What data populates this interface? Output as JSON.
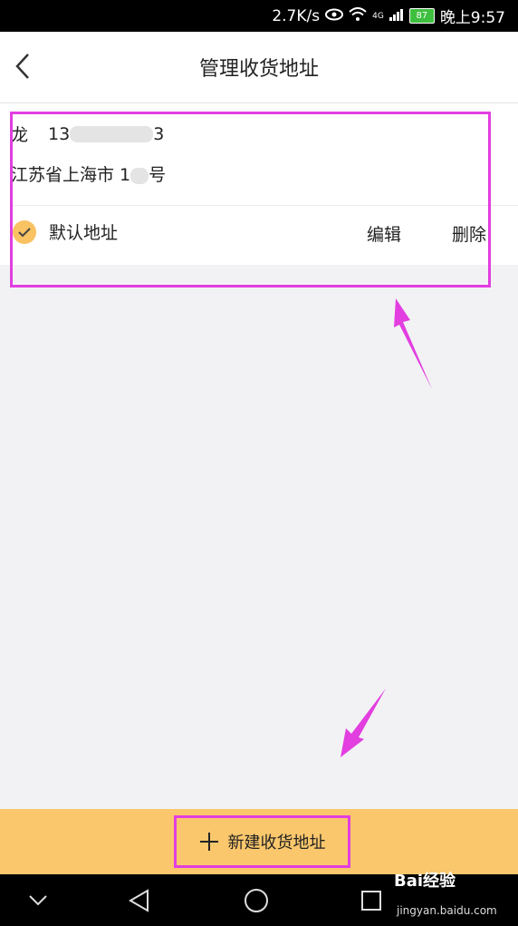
{
  "status_bar": {
    "speed": "2.7K/s",
    "network": "4G",
    "battery": "87",
    "time": "晚上9:57"
  },
  "header": {
    "title": "管理收货地址"
  },
  "address": {
    "name": "龙",
    "phone_start": "13",
    "phone_end": "3",
    "region": "江苏省上海市 1",
    "house_suffix": "号",
    "default_label": "默认地址",
    "edit_label": "编辑",
    "delete_label": "删除"
  },
  "footer": {
    "new_address_label": "新建收货地址"
  },
  "watermark": {
    "brand": "Bai经验",
    "url": "jingyan.baidu.com"
  },
  "colors": {
    "accent": "#fac76c",
    "check": "#f9c262",
    "annotation": "#e23ee0"
  }
}
